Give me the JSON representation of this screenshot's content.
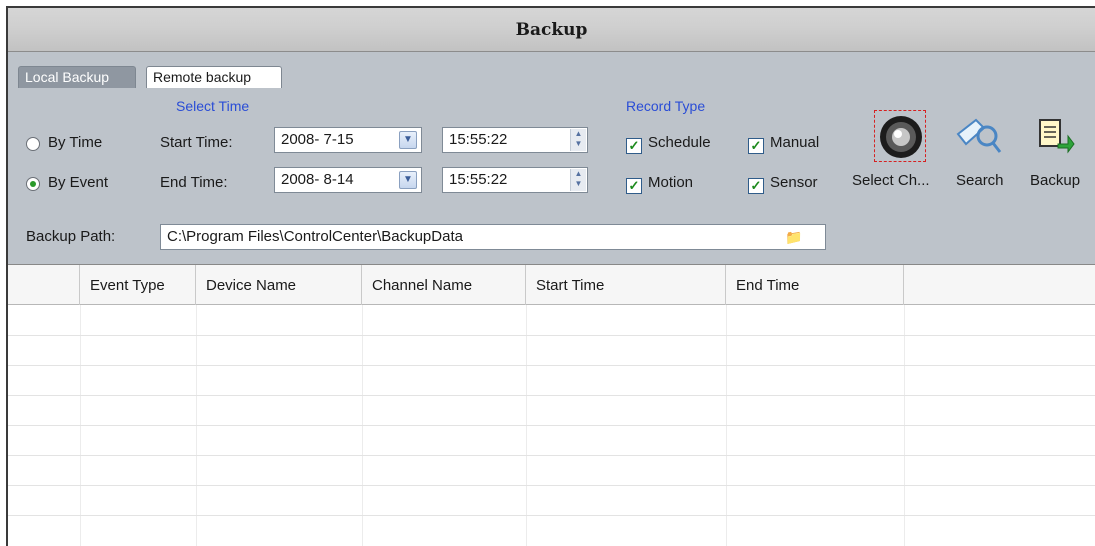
{
  "window": {
    "title": "Backup"
  },
  "tabs": [
    {
      "label": "Local Backup",
      "active": false
    },
    {
      "label": "Remote backup",
      "active": true
    }
  ],
  "select_time": {
    "heading": "Select Time",
    "by_time_label": "By Time",
    "by_event_label": "By Event",
    "selected_mode": "By Event",
    "start_label": "Start Time:",
    "end_label": "End Time:",
    "start_date": "2008- 7-15",
    "start_time": "15:55:22",
    "end_date": "2008- 8-14",
    "end_time": "15:55:22"
  },
  "record_type": {
    "heading": "Record Type",
    "schedule": {
      "label": "Schedule",
      "checked": true
    },
    "manual": {
      "label": "Manual",
      "checked": true
    },
    "motion": {
      "label": "Motion",
      "checked": true
    },
    "sensor": {
      "label": "Sensor",
      "checked": true
    }
  },
  "toolbar": {
    "select_channel_label": "Select Ch...",
    "search_label": "Search",
    "backup_label": "Backup"
  },
  "backup_path": {
    "label": "Backup Path:",
    "value": "C:\\Program Files\\ControlCenter\\BackupData"
  },
  "table": {
    "columns": [
      "",
      "Event Type",
      "Device Name",
      "Channel Name",
      "Start Time",
      "End Time",
      ""
    ],
    "rows": []
  },
  "colors": {
    "panel_bg": "#bdc3ca",
    "heading_blue": "#2a4dd6",
    "check_green": "#1c8a1c"
  },
  "icons": {
    "select_channel": "camera-icon",
    "search": "search-icon",
    "backup": "backup-document-icon",
    "date_dropdown": "chevron-down-icon",
    "time_spinner": "spinner-icon",
    "browse": "folder-icon"
  }
}
